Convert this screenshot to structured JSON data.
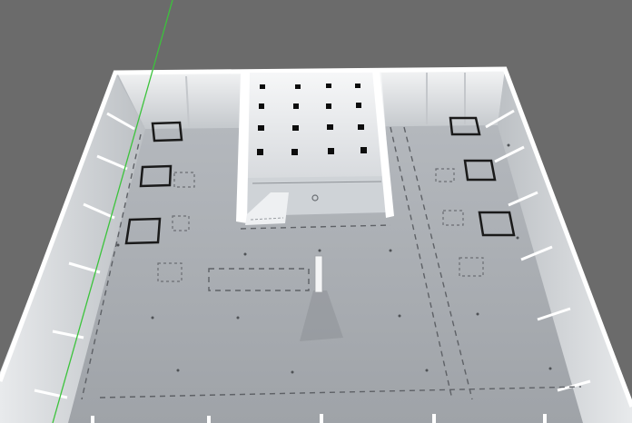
{
  "viewport": {
    "background": "#6b6b6b",
    "floor_color": "#a9adb3",
    "wall_color": "#d6dade",
    "axis_color": "#3cc33c"
  },
  "scene": {
    "objects": [
      {
        "name": "floor-plate",
        "kind": "floor"
      },
      {
        "name": "perimeter-wall",
        "kind": "wall"
      },
      {
        "name": "central-room",
        "kind": "room"
      },
      {
        "name": "vent-grid",
        "kind": "vents",
        "count": 16
      },
      {
        "name": "floor-markers",
        "kind": "outlined-squares",
        "count": 6
      },
      {
        "name": "center-post",
        "kind": "post"
      }
    ]
  }
}
